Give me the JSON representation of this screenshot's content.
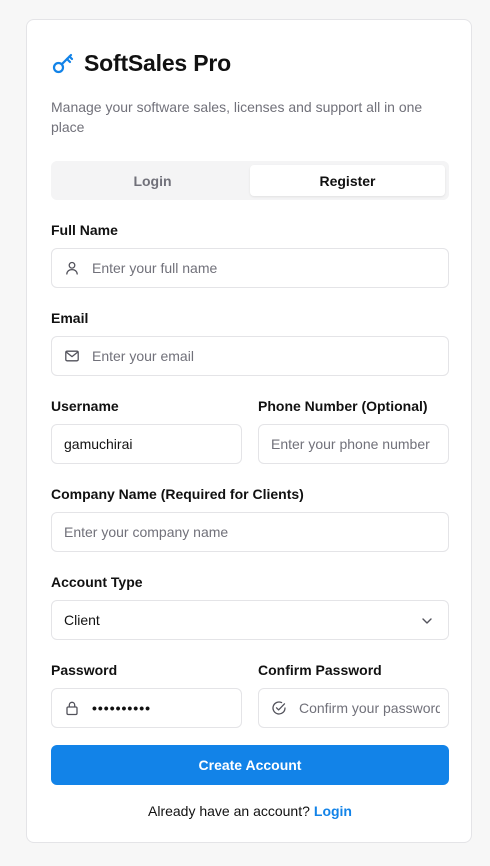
{
  "brand": {
    "name": "SoftSales Pro",
    "subtitle": "Manage your software sales, licenses and support all in one place",
    "accent_color": "#1283e8",
    "icon": "key-icon"
  },
  "tabs": [
    {
      "label": "Login",
      "active": false
    },
    {
      "label": "Register",
      "active": true
    }
  ],
  "form": {
    "full_name": {
      "label": "Full Name",
      "placeholder": "Enter your full name",
      "value": "",
      "icon": "user-icon"
    },
    "email": {
      "label": "Email",
      "placeholder": "Enter your email",
      "value": "",
      "icon": "mail-icon"
    },
    "username": {
      "label": "Username",
      "placeholder": "",
      "value": "gamuchirai"
    },
    "phone": {
      "label": "Phone Number (Optional)",
      "placeholder": "Enter your phone number",
      "value": ""
    },
    "company": {
      "label": "Company Name (Required for Clients)",
      "placeholder": "Enter your company name",
      "value": ""
    },
    "account_type": {
      "label": "Account Type",
      "selected": "Client"
    },
    "password": {
      "label": "Password",
      "masked_value": "••••••••••",
      "icon": "lock-icon"
    },
    "confirm_password": {
      "label": "Confirm Password",
      "placeholder": "Confirm your password",
      "value": "",
      "icon": "check-circle-icon"
    }
  },
  "submit_label": "Create Account",
  "footer": {
    "prompt": "Already have an account?",
    "link_label": "Login"
  }
}
